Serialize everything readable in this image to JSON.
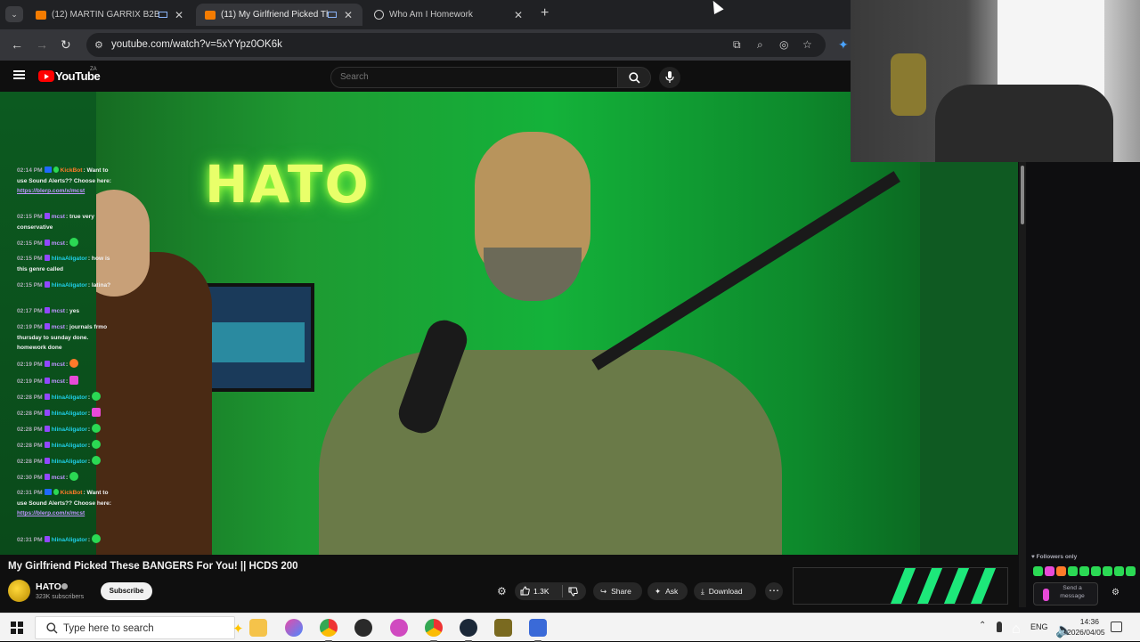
{
  "browser": {
    "tabs": [
      {
        "title": "(12) MARTIN GARRIX B2B A",
        "favicon": "youtube-icon",
        "active": false
      },
      {
        "title": "(11) My Girlfriend Picked Th",
        "favicon": "youtube-icon",
        "active": true
      },
      {
        "title": "Who Am I Homework",
        "favicon": "globe-icon",
        "active": false
      }
    ],
    "url": "youtube.com/watch?v=5xYYpz0OK6k"
  },
  "youtube": {
    "logo_text": "YouTube",
    "region": "ZA",
    "search_placeholder": "Search"
  },
  "video": {
    "neon_sign": "HATO",
    "title": "My Girlfriend Picked These BANGERS For You! || HCDS 200",
    "channel": "HATO",
    "subscribers": "323K subscribers",
    "subscribe_label": "Subscribe",
    "likes": "1.3K",
    "share_label": "Share",
    "ask_label": "Ask",
    "download_label": "Download",
    "more_label": "⋯"
  },
  "chat": {
    "messages": [
      {
        "time": "02:14 PM",
        "user": "KickBot",
        "user_color": "#ff7a2a",
        "text": "Want to use Sound Alerts?? Choose here:",
        "link": "https://blerp.com/x/mcst"
      },
      {
        "time": "02:15 PM",
        "user": "mcst",
        "user_color": "#bf94ff",
        "text": "true very conservative"
      },
      {
        "time": "02:15 PM",
        "user": "mcst",
        "user_color": "#bf94ff",
        "text": ""
      },
      {
        "time": "02:15 PM",
        "user": "hlinaAligator",
        "user_color": "#1ecfe8",
        "text": "how is this genre called"
      },
      {
        "time": "02:15 PM",
        "user": "hlinaAligator",
        "user_color": "#1ecfe8",
        "text": "latina?"
      },
      {
        "time": "02:17 PM",
        "user": "mcst",
        "user_color": "#bf94ff",
        "text": "yes"
      },
      {
        "time": "02:19 PM",
        "user": "mcst",
        "user_color": "#bf94ff",
        "text": "journals frmo thursday to sunday done. homework done"
      },
      {
        "time": "02:19 PM",
        "user": "mcst",
        "user_color": "#bf94ff",
        "text": ""
      },
      {
        "time": "02:19 PM",
        "user": "mcst",
        "user_color": "#bf94ff",
        "text": ""
      },
      {
        "time": "02:28 PM",
        "user": "hlinaAligator",
        "user_color": "#1ecfe8",
        "text": ""
      },
      {
        "time": "02:28 PM",
        "user": "hlinaAligator",
        "user_color": "#1ecfe8",
        "text": ""
      },
      {
        "time": "02:28 PM",
        "user": "hlinaAligator",
        "user_color": "#1ecfe8",
        "text": ""
      },
      {
        "time": "02:28 PM",
        "user": "hlinaAligator",
        "user_color": "#1ecfe8",
        "text": ""
      },
      {
        "time": "02:28 PM",
        "user": "hlinaAligator",
        "user_color": "#1ecfe8",
        "text": ""
      },
      {
        "time": "02:30 PM",
        "user": "mcst",
        "user_color": "#bf94ff",
        "text": ""
      },
      {
        "time": "02:31 PM",
        "user": "KickBot",
        "user_color": "#ff7a2a",
        "text": "Want to use Sound Alerts?? Choose here:",
        "link": "https://blerp.com/x/mcst"
      },
      {
        "time": "02:31 PM",
        "user": "hlinaAligator",
        "user_color": "#1ecfe8",
        "text": ""
      }
    ],
    "followers_only": "Followers only",
    "input_placeholder": "Send a message"
  },
  "taskbar": {
    "search_placeholder": "Type here to search",
    "language": "ENG",
    "time": "14:36",
    "date": "2026/04/05"
  }
}
